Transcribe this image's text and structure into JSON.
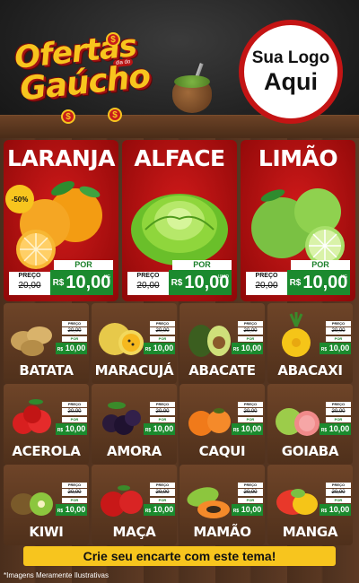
{
  "brand": {
    "line1": "Ofertas",
    "line2": "Gaúcho",
    "tag": "dia do"
  },
  "logo": {
    "line1": "Sua Logo",
    "line2": "Aqui"
  },
  "featured": [
    {
      "name": "LARANJA",
      "preco_label": "PREÇO",
      "old": "20,00",
      "por": "POR",
      "currency": "R$",
      "price": "10,00",
      "unit": "KG",
      "badge": "-50%"
    },
    {
      "name": "ALFACE",
      "preco_label": "PREÇO",
      "old": "20,00",
      "por": "POR",
      "currency": "R$",
      "price": "10,00",
      "unit": "UNID"
    },
    {
      "name": "LIMÃO",
      "preco_label": "PREÇO",
      "old": "20,00",
      "por": "POR",
      "currency": "R$",
      "price": "10,00",
      "unit": "KG"
    }
  ],
  "products": [
    {
      "name": "BATATA",
      "preco_label": "PREÇO",
      "old": "20,00",
      "por": "POR",
      "currency": "R$",
      "price": "10,00"
    },
    {
      "name": "MARACUJÁ",
      "preco_label": "PREÇO",
      "old": "20,00",
      "por": "POR",
      "currency": "R$",
      "price": "10,00"
    },
    {
      "name": "ABACATE",
      "preco_label": "PREÇO",
      "old": "20,00",
      "por": "POR",
      "currency": "R$",
      "price": "10,00"
    },
    {
      "name": "ABACAXI",
      "preco_label": "PREÇO",
      "old": "20,00",
      "por": "POR",
      "currency": "R$",
      "price": "10,00"
    },
    {
      "name": "ACEROLA",
      "preco_label": "PREÇO",
      "old": "20,00",
      "por": "POR",
      "currency": "R$",
      "price": "10,00"
    },
    {
      "name": "AMORA",
      "preco_label": "PREÇO",
      "old": "20,00",
      "por": "POR",
      "currency": "R$",
      "price": "10,00"
    },
    {
      "name": "CAQUI",
      "preco_label": "PREÇO",
      "old": "20,00",
      "por": "POR",
      "currency": "R$",
      "price": "10,00"
    },
    {
      "name": "GOIABA",
      "preco_label": "PREÇO",
      "old": "20,00",
      "por": "POR",
      "currency": "R$",
      "price": "10,00"
    },
    {
      "name": "KIWI",
      "preco_label": "PREÇO",
      "old": "20,00",
      "por": "POR",
      "currency": "R$",
      "price": "10,00"
    },
    {
      "name": "MAÇA",
      "preco_label": "PREÇO",
      "old": "20,00",
      "por": "POR",
      "currency": "R$",
      "price": "10,00"
    },
    {
      "name": "MAMÃO",
      "preco_label": "PREÇO",
      "old": "20,00",
      "por": "POR",
      "currency": "R$",
      "price": "10,00"
    },
    {
      "name": "MANGA",
      "preco_label": "PREÇO",
      "old": "20,00",
      "por": "POR",
      "currency": "R$",
      "price": "10,00"
    }
  ],
  "footer": {
    "cta": "Crie seu encarte com este tema!",
    "disclaimer": "*Imagens Meramente Ilustrativas"
  },
  "colors": {
    "red": "#c41414",
    "green": "#1b8a2e",
    "yellow": "#f7c51e",
    "wood": "#5a3822"
  }
}
